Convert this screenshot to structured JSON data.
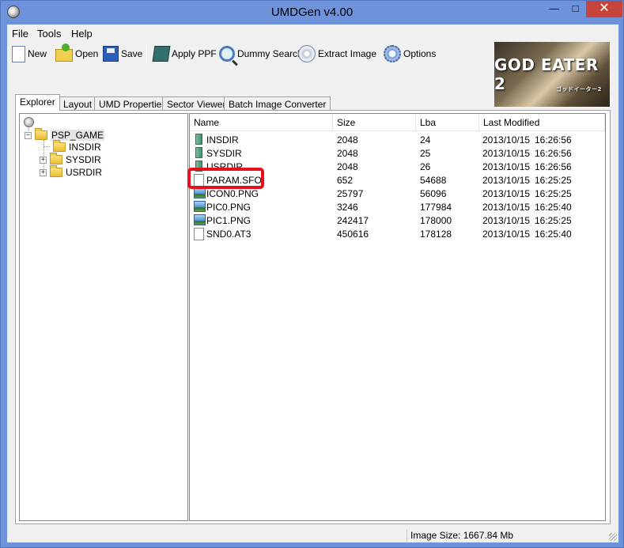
{
  "window": {
    "title": "UMDGen v4.00"
  },
  "window_controls": {
    "minimize": "—",
    "maximize": "□",
    "close": "✕"
  },
  "menu": {
    "items": [
      "File",
      "Tools",
      "Help"
    ]
  },
  "toolbar": {
    "buttons": [
      {
        "label": "New",
        "icon": "new-file-icon"
      },
      {
        "label": "Open",
        "icon": "open-folder-icon"
      },
      {
        "label": "Save",
        "icon": "save-disk-icon"
      },
      {
        "label": "Apply PPF",
        "icon": "ppf-box-icon"
      },
      {
        "label": "Dummy Search",
        "icon": "magnifier-icon"
      },
      {
        "label": "Extract Image",
        "icon": "disc-icon"
      },
      {
        "label": "Options",
        "icon": "gear-icon"
      }
    ]
  },
  "banner": {
    "title": "GOD EATER 2",
    "subtitle": "ゴッドイーター2"
  },
  "tabs": [
    "Explorer",
    "Layout",
    "UMD Properties",
    "Sector Viewer",
    "Batch Image Converter"
  ],
  "tree": {
    "root": "PSP_GAME",
    "children": [
      {
        "label": "INSDIR",
        "expandable": false
      },
      {
        "label": "SYSDIR",
        "expandable": true
      },
      {
        "label": "USRDIR",
        "expandable": true
      }
    ]
  },
  "list": {
    "columns": [
      "Name",
      "Size",
      "Lba",
      "Last Modified"
    ],
    "rows": [
      {
        "name": "INSDIR",
        "size": "2048",
        "lba": "24",
        "date": "2013/10/15",
        "time": "16:26:56",
        "icon": "folder-green-icon"
      },
      {
        "name": "SYSDIR",
        "size": "2048",
        "lba": "25",
        "date": "2013/10/15",
        "time": "16:26:56",
        "icon": "folder-green-icon"
      },
      {
        "name": "USRDIR",
        "size": "2048",
        "lba": "26",
        "date": "2013/10/15",
        "time": "16:26:56",
        "icon": "folder-green-icon"
      },
      {
        "name": "PARAM.SFO",
        "size": "652",
        "lba": "54688",
        "date": "2013/10/15",
        "time": "16:25:25",
        "icon": "document-icon"
      },
      {
        "name": "ICON0.PNG",
        "size": "25797",
        "lba": "56096",
        "date": "2013/10/15",
        "time": "16:25:25",
        "icon": "image-icon"
      },
      {
        "name": "PIC0.PNG",
        "size": "3246",
        "lba": "177984",
        "date": "2013/10/15",
        "time": "16:25:40",
        "icon": "image-icon"
      },
      {
        "name": "PIC1.PNG",
        "size": "242417",
        "lba": "178000",
        "date": "2013/10/15",
        "time": "16:25:25",
        "icon": "image-icon"
      },
      {
        "name": "SND0.AT3",
        "size": "450616",
        "lba": "178128",
        "date": "2013/10/15",
        "time": "16:25:40",
        "icon": "document-icon"
      }
    ]
  },
  "status": {
    "image_size": "Image Size: 1667.84 Mb"
  },
  "colors": {
    "title_bar": "#6e93da",
    "close_button": "#c7443a",
    "highlight": "#e4101c"
  }
}
